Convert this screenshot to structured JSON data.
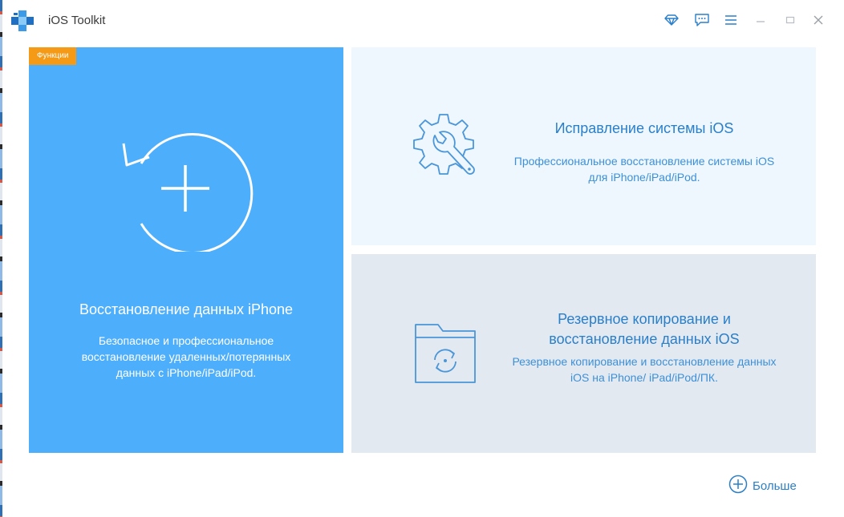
{
  "window": {
    "title": "iOS Toolkit",
    "controls": [
      "diamond-icon",
      "feedback-icon",
      "menu-icon",
      "minimize-icon",
      "maximize-icon",
      "close-icon"
    ]
  },
  "cards": {
    "data_recovery": {
      "badge": "Функции",
      "title": "Восстановление данных iPhone",
      "description": "Безопасное и профессиональное восстановление удаленных/потерянных данных с iPhone/iPad/iPod.",
      "icon": "restore-plus-icon",
      "bg": "#4daffb"
    },
    "system_repair": {
      "title": "Исправление системы iOS",
      "description": "Профессиональное восстановление системы iOS для iPhone/iPad/iPod.",
      "icon": "gear-wrench-icon",
      "bg": "#eef6fe"
    },
    "backup_restore": {
      "title": "Резервное копирование и восстановление данных iOS",
      "description": "Резервное копирование и восстановление данных iOS на iPhone/ iPad/iPod/ПК.",
      "icon": "folder-sync-icon",
      "bg": "#e3e9f1"
    }
  },
  "footer": {
    "more_label": "Больше",
    "icon": "plus-circle-icon"
  },
  "colors": {
    "accent": "#2a7fc9",
    "badge": "#f59a16"
  }
}
